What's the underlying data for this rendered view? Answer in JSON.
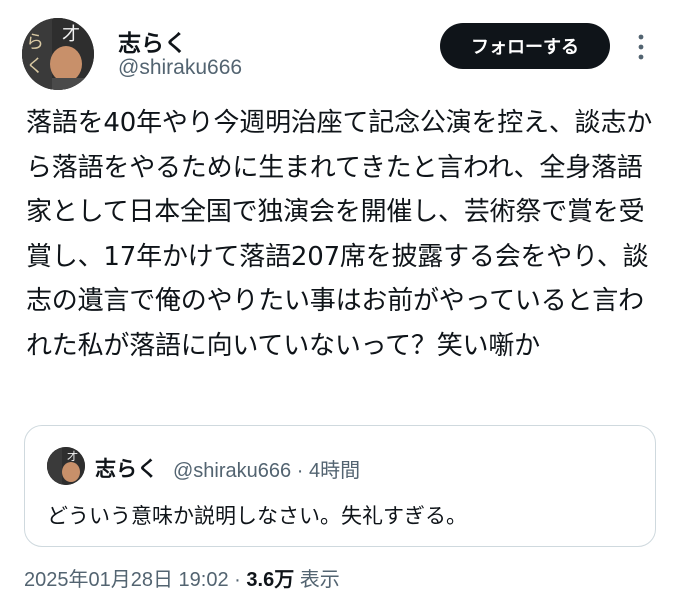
{
  "author": {
    "display_name": "志らく",
    "handle": "@shiraku666"
  },
  "follow_button_label": "フォローする",
  "tweet_text": "落語を40年やり今週明治座て記念公演を控え、談志から落語をやるために生まれてきたと言われ、全身落語家として日本全国で独演会を開催し、芸術祭で賞を受賞し、17年かけて落語207席を披露する会をやり、談志の遺言で俺のやりたい事はお前がやっていると言われた私が落語に向いていないって？笑い噺か",
  "quote": {
    "display_name": "志らく",
    "handle": "@shiraku666",
    "separator": "·",
    "time": "4時間",
    "text": "どういう意味か説明しなさい。失礼すぎる。"
  },
  "footer": {
    "timestamp": "2025年01月28日 19:02",
    "separator": "·",
    "views_count": "3.6万",
    "views_label": "表示"
  },
  "icons": {
    "more": "more-vertical-icon"
  },
  "colors": {
    "text_primary": "#0f1419",
    "text_secondary": "#536471",
    "button_bg": "#0f1419",
    "border": "#cfd9de"
  }
}
